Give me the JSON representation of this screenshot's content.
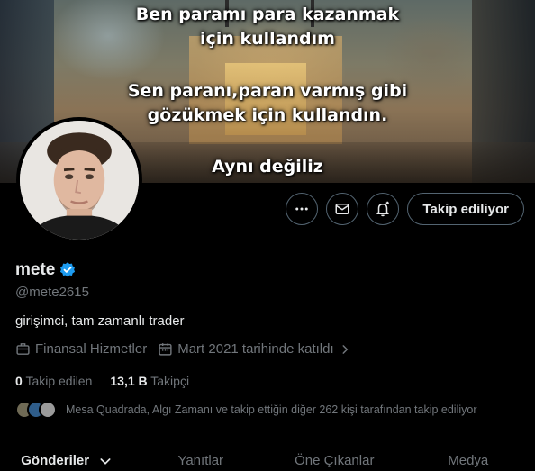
{
  "banner": {
    "lines": [
      "Ben paramı para kazanmak",
      "için kullandım",
      "Sen paranı,paran varmış gibi",
      "gözükmek için kullandın.",
      "Aynı değiliz"
    ]
  },
  "profile": {
    "name": "mete",
    "handle": "@mete2615",
    "bio": "girişimci, tam zamanlı trader",
    "category": "Finansal Hizmetler",
    "joined": "Mart 2021 tarihinde katıldı",
    "following_count": "0",
    "following_label": "Takip edilen",
    "followers_count": "13,1 B",
    "followers_label": "Takipçi",
    "known_followers": "Mesa Quadrada, Algı Zamanı ve takip ettiğin diğer 262 kişi tarafından takip ediliyor"
  },
  "actions": {
    "follow_label": "Takip ediliyor",
    "icons": [
      "more-icon",
      "message-icon",
      "notification-bell-icon"
    ]
  },
  "tabs": [
    {
      "label": "Gönderiler",
      "active": true
    },
    {
      "label": "Yanıtlar",
      "active": false
    },
    {
      "label": "Öne Çıkanlar",
      "active": false
    },
    {
      "label": "Medya",
      "active": false
    }
  ],
  "colors": {
    "background": "#000000",
    "text": "#e7e9ea",
    "secondary_text": "#71767b",
    "border": "#536471",
    "verified": "#1d9bf0"
  }
}
